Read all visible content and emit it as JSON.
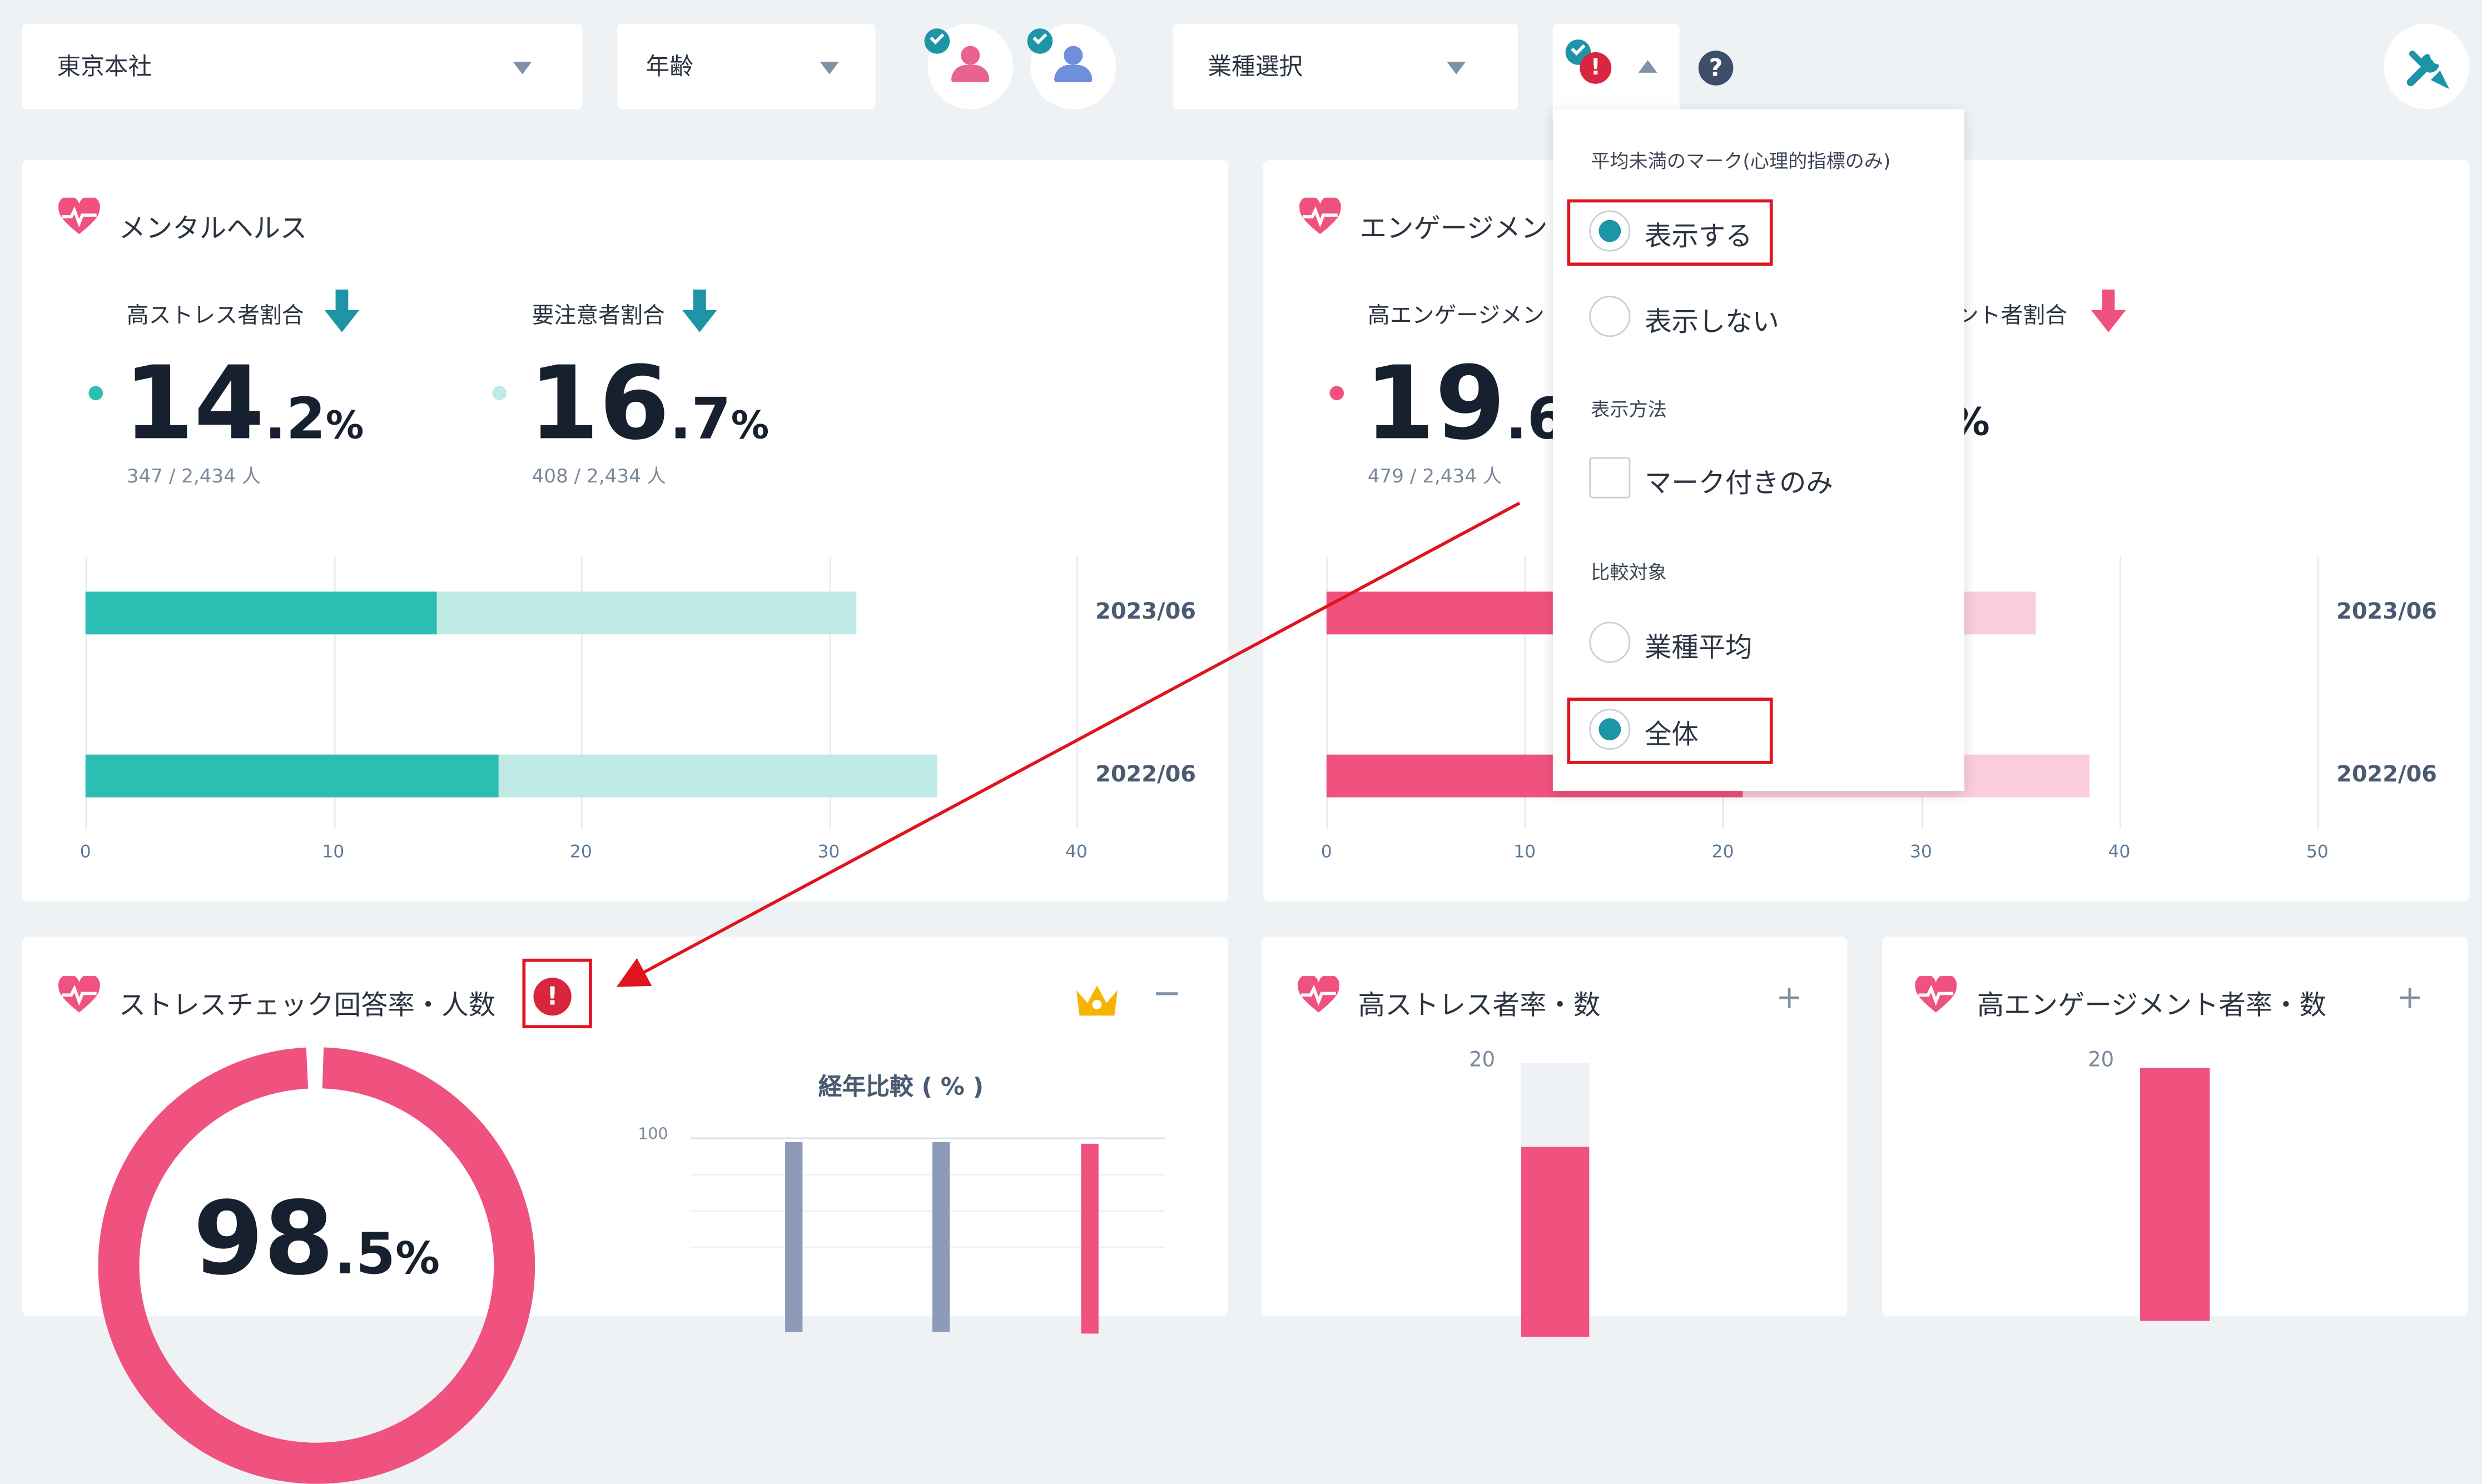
{
  "filters": {
    "office": "東京本社",
    "age": "年齢",
    "industry": "業種選択"
  },
  "colors": {
    "teal": "#2bbfb3",
    "teal_light": "#bfeae6",
    "pink": "#f0527f",
    "pink_light": "#fbcdda",
    "gray_bar": "#8e9bb8",
    "alert": "#d7263d",
    "crown": "#f5b400"
  },
  "dropdown": {
    "section_mark": "平均未満のマーク(心理的指標のみ)",
    "opt_show": "表示する",
    "opt_hide": "表示しない",
    "section_method": "表示方法",
    "opt_marked_only": "マーク付きのみ",
    "section_compare": "比較対象",
    "opt_industry_avg": "業種平均",
    "opt_all": "全体",
    "selected_mark": "表示する",
    "selected_compare": "全体",
    "marked_only_checked": false
  },
  "mental": {
    "title": "メンタルヘルス",
    "m1": {
      "label": "高ストレス者割合",
      "int": "14",
      "dec": ".2",
      "pct": "%",
      "sub": "347 / 2,434 人"
    },
    "m2": {
      "label": "要注意者割合",
      "int": "16",
      "dec": ".7",
      "pct": "%",
      "sub": "408 / 2,434 人"
    },
    "chart_data": {
      "type": "bar",
      "orientation": "horizontal",
      "stacked": true,
      "categories": [
        "2023/06",
        "2022/06"
      ],
      "series": [
        {
          "name": "高ストレス者割合",
          "values": [
            14.2,
            16.7
          ]
        },
        {
          "name": "要注意者割合",
          "values": [
            16.9,
            17.7
          ]
        }
      ],
      "xticks": [
        "0",
        "10",
        "20",
        "30",
        "40"
      ],
      "xlim": [
        0,
        40
      ]
    }
  },
  "engagement": {
    "title": "エンゲージメン",
    "m1": {
      "label": "高エンゲージメン",
      "int": "19",
      "dec": ".6",
      "sub": "479 / 2,434 人"
    },
    "m2": {
      "label": "ント者割合"
    },
    "partial_pct": "%",
    "chart_data": {
      "type": "bar",
      "orientation": "horizontal",
      "stacked": true,
      "categories": [
        "2023/06",
        "2022/06"
      ],
      "series": [
        {
          "values": [
            19.6,
            21.0
          ]
        },
        {
          "values": [
            16.2,
            17.5
          ]
        }
      ],
      "xticks": [
        "0",
        "10",
        "20",
        "30",
        "40",
        "50"
      ],
      "xlim": [
        0,
        50
      ]
    }
  },
  "stress_check": {
    "title": "ストレスチェック回答率・人数",
    "donut_int": "98",
    "donut_dec": ".5",
    "donut_pct": "%",
    "donut_value": 98.5,
    "yearly_title": "経年比較 ( % )",
    "yearly_tick": "100",
    "minus": "−"
  },
  "high_stress": {
    "title": "高ストレス者率・数",
    "tick": "20",
    "plus": "+"
  },
  "high_engagement": {
    "title": "高エンゲージメント者率・数",
    "tick": "20",
    "plus": "+"
  },
  "icons": [
    "chevron-down-icon",
    "female-user-icon",
    "male-user-icon",
    "alert-icon",
    "chevron-up-icon",
    "help-icon",
    "tools-icon",
    "heart-pulse-icon",
    "crown-icon",
    "arrow-down-icon"
  ]
}
